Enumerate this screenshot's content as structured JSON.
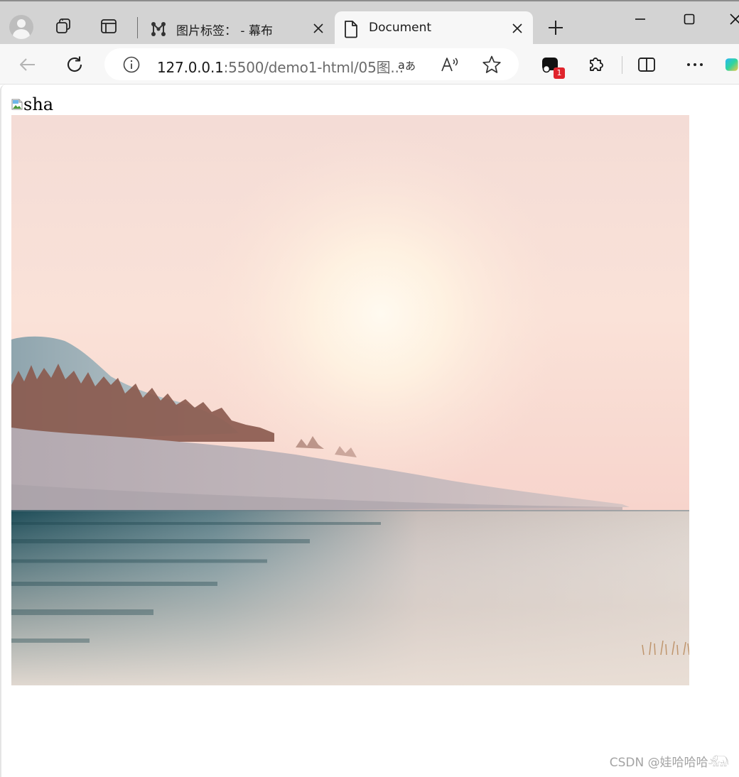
{
  "browser": {
    "tabs": [
      {
        "title": "图片标签： - 幕布",
        "icon": "mubu-graph-icon",
        "active": false
      },
      {
        "title": "Document",
        "icon": "document-page-icon",
        "active": true
      }
    ],
    "new_tab_icon": "plus-icon"
  },
  "address_bar": {
    "url_host": "127.0.0.1",
    "url_path": ":5500/demo1-html/05图...",
    "site_info_icon": "info-circle-icon"
  },
  "toolbar": {
    "extension_badge": "1",
    "icons": [
      "back-arrow-icon",
      "refresh-icon",
      "read-aloud-icon",
      "favorite-star-icon",
      "extensions-puzzle-icon",
      "split-screen-icon",
      "more-dots-icon",
      "copilot-icon"
    ]
  },
  "page": {
    "broken_image_alt": "sha",
    "photo": {
      "description_name": "lakeside-sunrise-photo",
      "colors": {
        "sky_top": "#f7dcd6",
        "sun_glow": "#fff6e6",
        "sky_horizon": "#f8d6cf",
        "hill": "#93a7b1",
        "rock": "#b8afb4",
        "trees": "#8a5a4e",
        "water_dark": "#24525d",
        "water_light": "#e4dcd5"
      }
    },
    "watermark": "CSDN @娃哈哈哈𓃰"
  }
}
